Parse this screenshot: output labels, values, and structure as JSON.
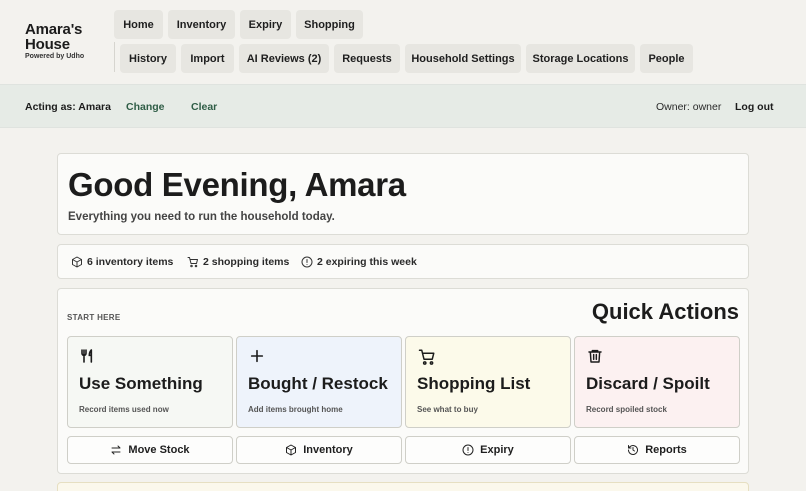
{
  "brand": {
    "name_line1": "Amara's",
    "name_line2": "House",
    "powered": "Powered by Udho"
  },
  "nav": {
    "row1": [
      "Home",
      "Inventory",
      "Expiry",
      "Shopping"
    ],
    "row2": [
      "History",
      "Import",
      "AI Reviews (2)",
      "Requests",
      "Household Settings",
      "Storage Locations",
      "People"
    ]
  },
  "acting": {
    "label": "Acting as: Amara",
    "change": "Change",
    "clear": "Clear",
    "owner": "Owner: owner",
    "logout": "Log out"
  },
  "hero": {
    "title": "Good Evening, Amara",
    "subtitle": "Everything you need to run the household today."
  },
  "stats": [
    {
      "icon": "box-icon",
      "text": "6 inventory items"
    },
    {
      "icon": "cart-icon",
      "text": "2 shopping items"
    },
    {
      "icon": "alert-circle-icon",
      "text": "2 expiring this week"
    }
  ],
  "quick_actions": {
    "eyebrow": "START HERE",
    "title": "Quick Actions",
    "tiles": [
      {
        "icon": "utensils-icon",
        "title": "Use Something",
        "subtitle": "Record items used now",
        "bg": "#f6f8f4"
      },
      {
        "icon": "plus-icon",
        "title": "Bought / Restock",
        "subtitle": "Add items brought home",
        "bg": "#eef3fb"
      },
      {
        "icon": "cart-icon",
        "title": "Shopping List",
        "subtitle": "See what to buy",
        "bg": "#fcfaea"
      },
      {
        "icon": "trash-icon",
        "title": "Discard / Spoilt",
        "subtitle": "Record spoiled stock",
        "bg": "#fcf1f1"
      }
    ],
    "buttons": [
      {
        "icon": "transfer-icon",
        "label": "Move Stock"
      },
      {
        "icon": "box-icon",
        "label": "Inventory"
      },
      {
        "icon": "alert-circle-icon",
        "label": "Expiry"
      },
      {
        "icon": "history-icon",
        "label": "Reports"
      }
    ]
  }
}
